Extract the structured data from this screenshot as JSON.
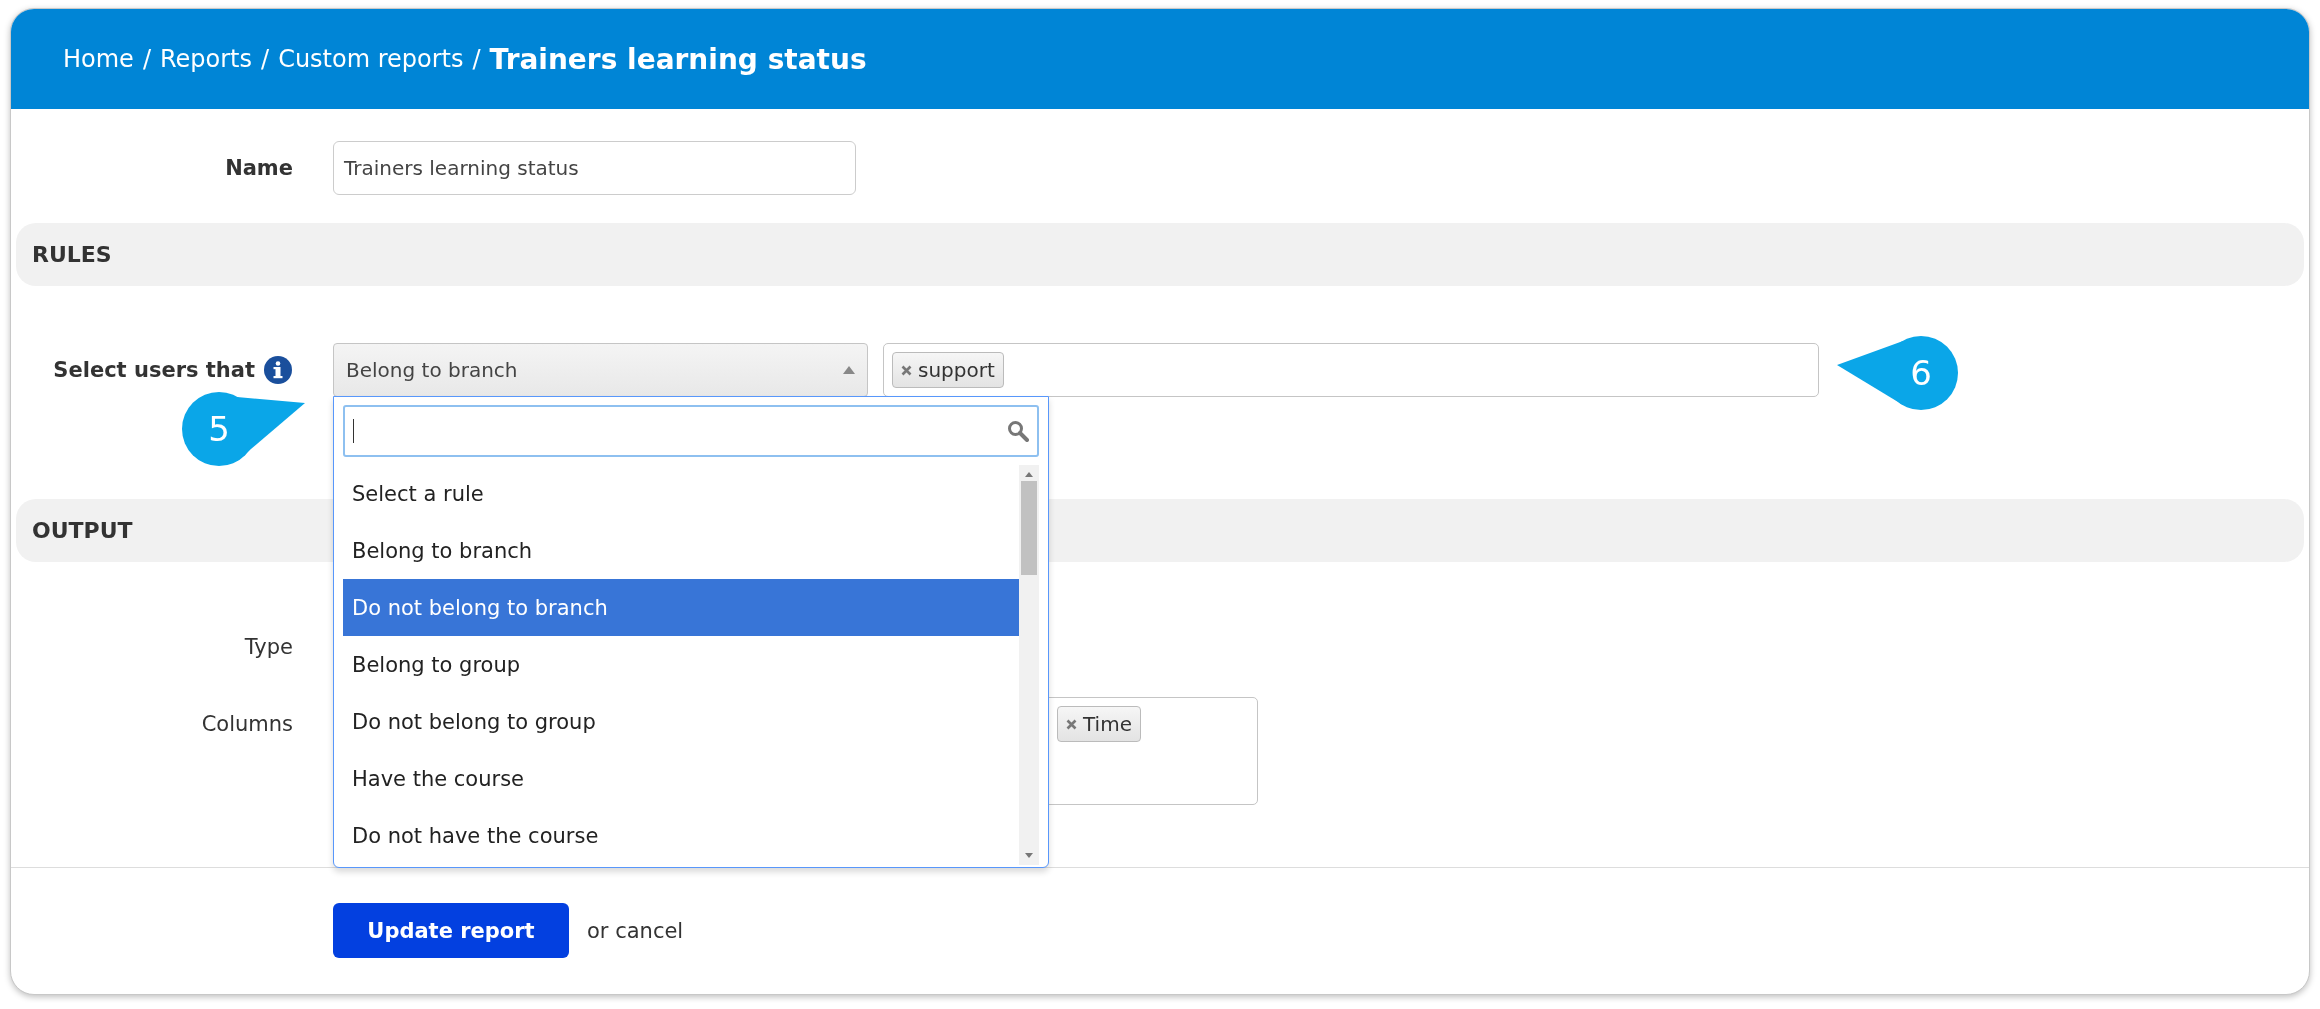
{
  "breadcrumb": {
    "items": [
      {
        "label": "Home",
        "separator": "/"
      },
      {
        "label": "Reports",
        "separator": "/"
      },
      {
        "label": "Custom reports",
        "separator": "/"
      }
    ],
    "current": "Trainers learning status"
  },
  "name_field": {
    "label": "Name",
    "value": "Trainers learning status"
  },
  "rules": {
    "title": "RULES",
    "select_label": "Select users that",
    "select": {
      "value": "Belong to branch",
      "expanded": true
    },
    "tags": [
      "support"
    ],
    "dropdown": {
      "options": [
        {
          "label": "Select a rule",
          "highlighted": false
        },
        {
          "label": "Belong to branch",
          "highlighted": false
        },
        {
          "label": "Do not belong to branch",
          "highlighted": true
        },
        {
          "label": "Belong to group",
          "highlighted": false
        },
        {
          "label": "Do not belong to group",
          "highlighted": false
        },
        {
          "label": "Have the course",
          "highlighted": false
        },
        {
          "label": "Do not have the course",
          "highlighted": false
        }
      ]
    }
  },
  "output": {
    "title": "OUTPUT",
    "type_label": "Type",
    "columns_label": "Columns",
    "columns_tags": [
      "Time"
    ]
  },
  "actions": {
    "submit": "Update report",
    "cancel": "or cancel"
  },
  "callouts": [
    "5",
    "6"
  ]
}
